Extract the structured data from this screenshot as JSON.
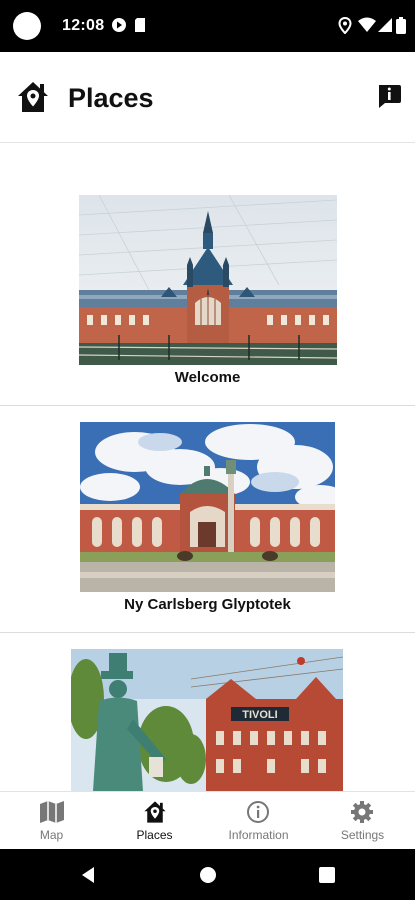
{
  "status_bar": {
    "time": "12:08"
  },
  "app_bar": {
    "title": "Places"
  },
  "places": [
    {
      "caption": "Welcome"
    },
    {
      "caption": "Ny Carlsberg Glyptotek"
    },
    {
      "caption": ""
    }
  ],
  "bottom_nav": {
    "items": [
      {
        "label": "Map",
        "icon": "map-icon",
        "active": false
      },
      {
        "label": "Places",
        "icon": "house-pin-icon",
        "active": true
      },
      {
        "label": "Information",
        "icon": "info-icon",
        "active": false
      },
      {
        "label": "Settings",
        "icon": "gear-icon",
        "active": false
      }
    ]
  },
  "colors": {
    "status_bar": "#000000",
    "active_nav": "#111111",
    "inactive_nav": "#777777"
  }
}
